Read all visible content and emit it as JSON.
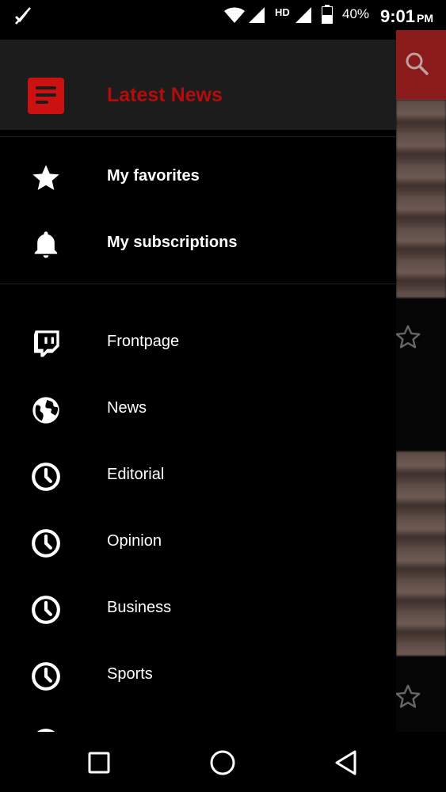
{
  "status_bar": {
    "network": "HD",
    "battery": "40%",
    "time": "9:01",
    "ampm": "PM"
  },
  "drawer": {
    "app_title": "Latest News",
    "primary_items": [
      {
        "label": "My favorites",
        "icon": "star-icon"
      },
      {
        "label": "My subscriptions",
        "icon": "bell-icon"
      }
    ],
    "categories": [
      {
        "label": "Frontpage",
        "icon": "twitch-icon"
      },
      {
        "label": "News",
        "icon": "globe-icon"
      },
      {
        "label": "Editorial",
        "icon": "clock-icon"
      },
      {
        "label": "Opinion",
        "icon": "clock-icon"
      },
      {
        "label": "Business",
        "icon": "clock-icon"
      },
      {
        "label": "Sports",
        "icon": "clock-icon"
      }
    ]
  },
  "colors": {
    "accent": "#cc1111",
    "title": "#b30c0c",
    "header_bg": "#1c1c1c",
    "background": "#000000"
  }
}
